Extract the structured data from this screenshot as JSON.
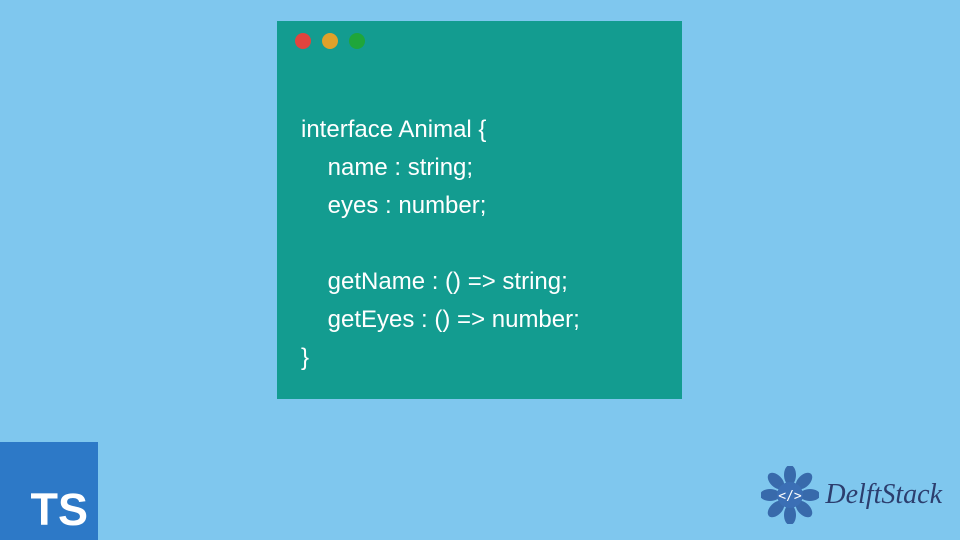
{
  "code": {
    "lines": [
      "interface Animal {",
      "    name : string;",
      "    eyes : number;",
      "",
      "    getName : () => string;",
      "    getEyes : () => number;",
      "}"
    ]
  },
  "ts_badge": {
    "label": "TS"
  },
  "brand": {
    "name": "DelftStack"
  },
  "colors": {
    "background": "#7fc7ee",
    "code_bg": "#139c90",
    "ts_bg": "#2d79c7",
    "brand_text": "#2c3e6e"
  }
}
